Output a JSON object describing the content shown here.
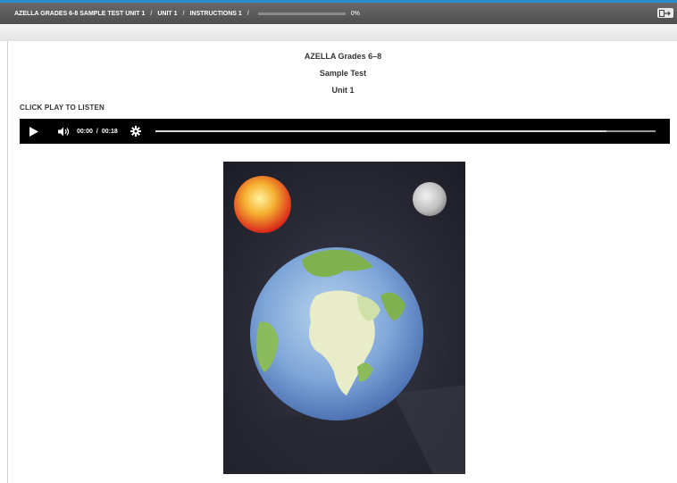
{
  "breadcrumb": {
    "items": [
      "AZELLA GRADES 6-8 SAMPLE TEST UNIT 1",
      "UNIT 1",
      "INSTRUCTIONS 1"
    ],
    "separator": "/",
    "progress_percent": 0,
    "progress_text": "0%"
  },
  "header": {
    "line1": "AZELLA Grades 6–8",
    "line2": "Sample Test",
    "line3": "Unit 1"
  },
  "instruction": {
    "label": "CLICK PLAY TO LISTEN"
  },
  "audio": {
    "current_time": "00:00",
    "time_separator": "/",
    "duration": "00:18",
    "play_icon": "play-icon",
    "volume_icon": "volume-icon",
    "settings_icon": "gear-icon"
  },
  "image": {
    "subject": "earth-sun-moon-drawing"
  },
  "colors": {
    "accent": "#2a8fd0",
    "toolbar": "#5a5a5a",
    "player_bg": "#000000"
  }
}
